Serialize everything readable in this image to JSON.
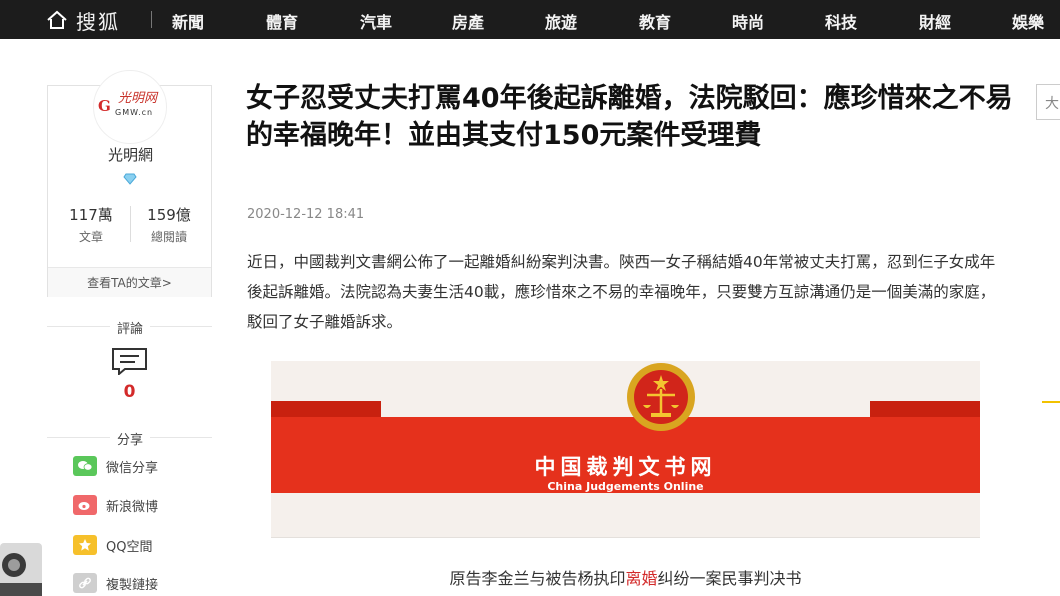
{
  "nav": {
    "logo": "搜狐",
    "items": [
      "新聞",
      "體育",
      "汽車",
      "房產",
      "旅遊",
      "教育",
      "時尚",
      "科技",
      "財經",
      "娛樂"
    ]
  },
  "author": {
    "logo_text": "光明网",
    "logo_sub": "GMW.cn",
    "name": "光明網",
    "articles_count": "117萬",
    "articles_label": "文章",
    "reads_count": "159億",
    "reads_label": "總閱讀",
    "view_articles": "查看TA的文章>"
  },
  "sidebar": {
    "comments_label": "評論",
    "comments_count": "0",
    "share_label": "分享",
    "share_items": [
      {
        "label": "微信分享",
        "icon": "wechat-icon",
        "color": "#5ac75a"
      },
      {
        "label": "新浪微博",
        "icon": "weibo-icon",
        "color": "#f0686a"
      },
      {
        "label": "QQ空間",
        "icon": "qzone-icon",
        "color": "#f6c02b"
      },
      {
        "label": "複製鏈接",
        "icon": "link-icon",
        "color": "#cfcfcf"
      }
    ]
  },
  "article": {
    "title": "女子忍受丈夫打罵40年後起訴離婚，法院駁回：應珍惜來之不易的幸福晚年！並由其支付150元案件受理費",
    "date": "2020-12-12 18:41",
    "body": "近日，中國裁判文書網公佈了一起離婚糾紛案判決書。陝西一女子稱結婚40年常被丈夫打罵，忍到仨子女成年後起訴離婚。法院認為夫妻生活40載，應珍惜來之不易的幸福晚年，只要雙方互諒溝通仍是一個美滿的家庭，駁回了女子離婚訴求。"
  },
  "embed": {
    "site_cn": "中国裁判文书网",
    "site_en": "China Judgements Online",
    "doc_title_pre": "原告李金兰与被告杨执印",
    "doc_title_hl": "离婚",
    "doc_title_post": "纠纷一案民事判决书"
  },
  "colors": {
    "nav_bg": "#1c1c1c",
    "accent_red": "#d32a2a",
    "banner_red": "#e5311c"
  }
}
